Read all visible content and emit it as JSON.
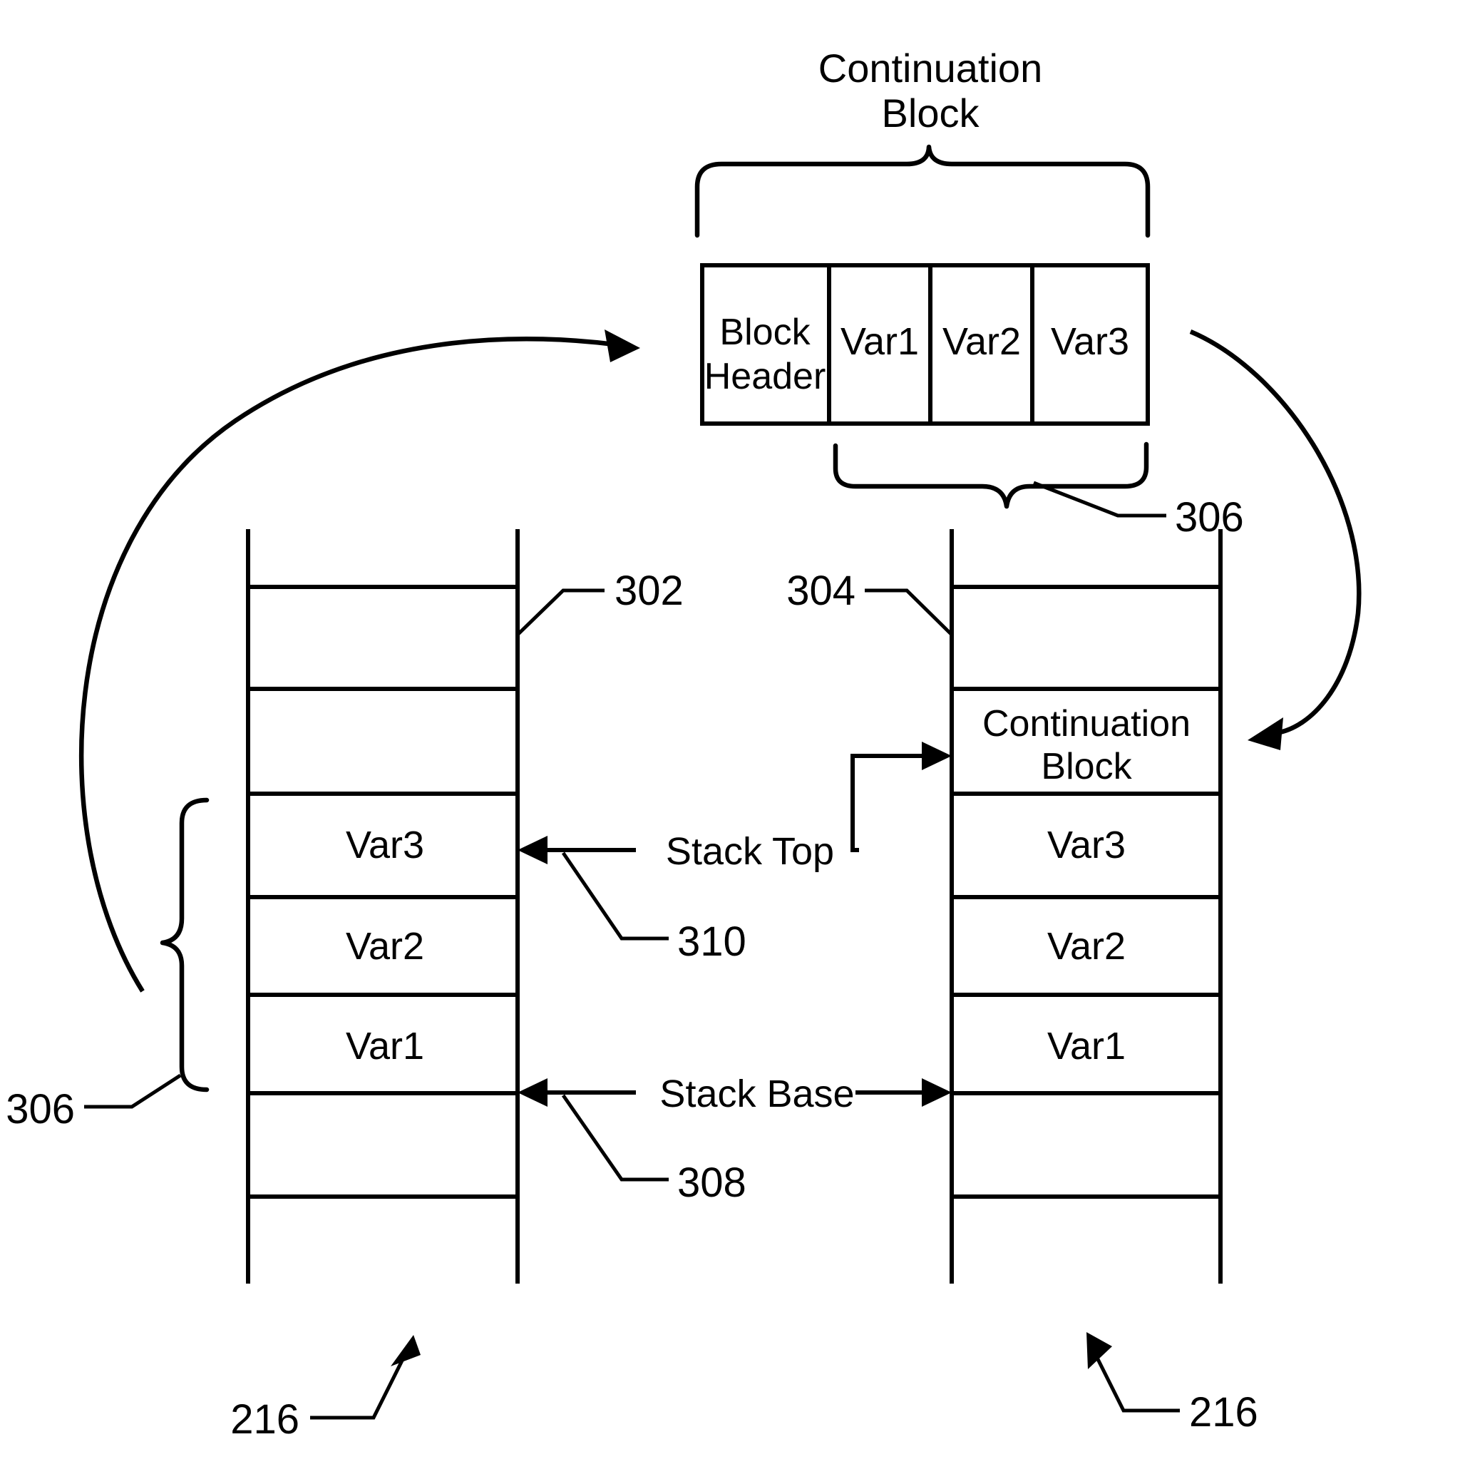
{
  "figure": {
    "title": {
      "line1": "Continuation",
      "line2": "Block"
    },
    "continuation_block": {
      "cells": [
        {
          "id": "block-header",
          "line1": "Block",
          "line2": "Header"
        },
        {
          "id": "var1",
          "label": "Var1"
        },
        {
          "id": "var2",
          "label": "Var2"
        },
        {
          "id": "var3",
          "label": "Var3"
        }
      ],
      "bottom_brace_ref": "306"
    },
    "left_stack": {
      "ref": "302",
      "bottom_ref": "216",
      "brace_ref": "306",
      "rows": [
        {
          "label": ""
        },
        {
          "label": ""
        },
        {
          "label": "Var3"
        },
        {
          "label": "Var2"
        },
        {
          "label": "Var1"
        },
        {
          "label": ""
        },
        {
          "label": ""
        }
      ]
    },
    "right_stack": {
      "ref": "304",
      "bottom_ref": "216",
      "rows": [
        {
          "label": ""
        },
        {
          "line1": "Continuation",
          "line2": "Block"
        },
        {
          "label": "Var3"
        },
        {
          "label": "Var2"
        },
        {
          "label": "Var1"
        },
        {
          "label": ""
        },
        {
          "label": ""
        }
      ]
    },
    "pointers": {
      "stack_top": {
        "label": "Stack Top",
        "ref": "310"
      },
      "stack_base": {
        "label": "Stack Base",
        "ref": "308"
      }
    }
  }
}
